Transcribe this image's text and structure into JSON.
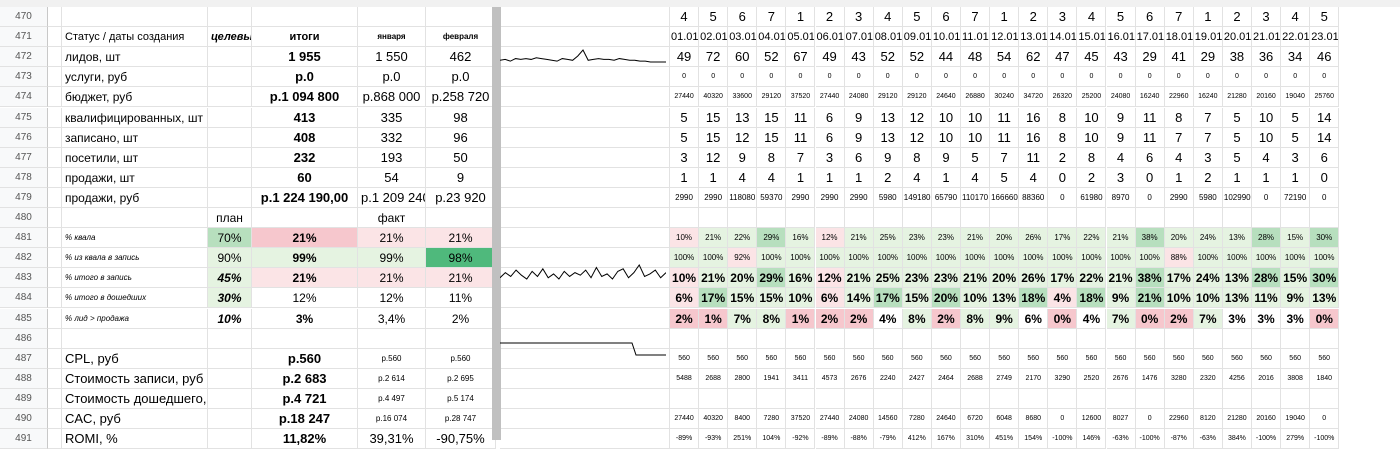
{
  "rows": {
    "470": {
      "cells": {
        "6": "4",
        "7": "5",
        "8": "6",
        "9": "7",
        "10": "1",
        "11": "2",
        "12": "3",
        "13": "4",
        "14": "5",
        "15": "6",
        "16": "7",
        "17": "1",
        "18": "2",
        "19": "3",
        "20": "4",
        "21": "5",
        "22": "6",
        "23": "7",
        "24": "1",
        "25": "2",
        "26": "3",
        "27": "4",
        "28": "5"
      }
    },
    "471": {
      "cells": {
        "1": "Статус / даты создания",
        "2": "целевы",
        "3": "итоги",
        "4": "января",
        "5": "февраля",
        "6": "01.01.",
        "7": "02.01.",
        "8": "03.01.",
        "9": "04.01.",
        "10": "05.01.",
        "11": "06.01.",
        "12": "07.01.",
        "13": "08.01.",
        "14": "09.01.",
        "15": "10.01.",
        "16": "11.01.",
        "17": "12.01.",
        "18": "13.01.",
        "19": "14.01.",
        "20": "15.01.",
        "21": "16.01.",
        "22": "17.01.",
        "23": "18.01.",
        "24": "19.01.",
        "25": "20.01.",
        "26": "21.01.",
        "27": "22.01.",
        "28": "23.01."
      }
    },
    "472": {
      "cells": {
        "1": "лидов, шт",
        "3": "1 955",
        "4": "1 550",
        "5": "462",
        "6": "49",
        "7": "72",
        "8": "60",
        "9": "52",
        "10": "67",
        "11": "49",
        "12": "43",
        "13": "52",
        "14": "52",
        "15": "44",
        "16": "48",
        "17": "54",
        "18": "62",
        "19": "47",
        "20": "45",
        "21": "43",
        "22": "29",
        "23": "41",
        "24": "29",
        "25": "38",
        "26": "36",
        "27": "34",
        "28": "46"
      }
    },
    "473": {
      "cells": {
        "1": "услуги, руб",
        "3": "р.0",
        "4": "р.0",
        "5": "р.0",
        "6": "0",
        "7": "0",
        "8": "0",
        "9": "0",
        "10": "0",
        "11": "0",
        "12": "0",
        "13": "0",
        "14": "0",
        "15": "0",
        "16": "0",
        "17": "0",
        "18": "0",
        "19": "0",
        "20": "0",
        "21": "0",
        "22": "0",
        "23": "0",
        "24": "0",
        "25": "0",
        "26": "0",
        "27": "0",
        "28": "0"
      }
    },
    "474": {
      "cells": {
        "1": "бюджет, руб",
        "3": "р.1 094 800",
        "4": "р.868 000",
        "5": "р.258 720",
        "6": "27440",
        "7": "40320",
        "8": "33600",
        "9": "29120",
        "10": "37520",
        "11": "27440",
        "12": "24080",
        "13": "29120",
        "14": "29120",
        "15": "24640",
        "16": "26880",
        "17": "30240",
        "18": "34720",
        "19": "26320",
        "20": "25200",
        "21": "24080",
        "22": "16240",
        "23": "22960",
        "24": "16240",
        "25": "21280",
        "26": "20160",
        "27": "19040",
        "28": "25760"
      }
    },
    "475": {
      "cells": {
        "1": "квалифицированных, шт",
        "3": "413",
        "4": "335",
        "5": "98",
        "6": "5",
        "7": "15",
        "8": "13",
        "9": "15",
        "10": "11",
        "11": "6",
        "12": "9",
        "13": "13",
        "14": "12",
        "15": "10",
        "16": "10",
        "17": "11",
        "18": "16",
        "19": "8",
        "20": "10",
        "21": "9",
        "22": "11",
        "23": "8",
        "24": "7",
        "25": "5",
        "26": "10",
        "27": "5",
        "28": "14"
      }
    },
    "476": {
      "cells": {
        "1": "записано, шт",
        "3": "408",
        "4": "332",
        "5": "96",
        "6": "5",
        "7": "15",
        "8": "12",
        "9": "15",
        "10": "11",
        "11": "6",
        "12": "9",
        "13": "13",
        "14": "12",
        "15": "10",
        "16": "10",
        "17": "11",
        "18": "16",
        "19": "8",
        "20": "10",
        "21": "9",
        "22": "11",
        "23": "7",
        "24": "7",
        "25": "5",
        "26": "10",
        "27": "5",
        "28": "14"
      }
    },
    "477": {
      "cells": {
        "1": "посетили, шт",
        "3": "232",
        "4": "193",
        "5": "50",
        "6": "3",
        "7": "12",
        "8": "9",
        "9": "8",
        "10": "7",
        "11": "3",
        "12": "6",
        "13": "9",
        "14": "8",
        "15": "9",
        "16": "5",
        "17": "7",
        "18": "11",
        "19": "2",
        "20": "8",
        "21": "4",
        "22": "6",
        "23": "4",
        "24": "3",
        "25": "5",
        "26": "4",
        "27": "3",
        "28": "6"
      }
    },
    "478": {
      "cells": {
        "1": "продажи, шт",
        "3": "60",
        "4": "54",
        "5": "9",
        "6": "1",
        "7": "1",
        "8": "4",
        "9": "4",
        "10": "1",
        "11": "1",
        "12": "1",
        "13": "2",
        "14": "4",
        "15": "1",
        "16": "4",
        "17": "5",
        "18": "4",
        "19": "0",
        "20": "2",
        "21": "3",
        "22": "0",
        "23": "1",
        "24": "2",
        "25": "1",
        "26": "1",
        "27": "1",
        "28": "0"
      }
    },
    "479": {
      "cells": {
        "1": "продажи, руб",
        "3": "р.1 224 190,00",
        "4": "р.1 209 240",
        "5": "р.23 920",
        "6": "2990",
        "7": "2990",
        "8": "118080",
        "9": "59370",
        "10": "2990",
        "11": "2990",
        "12": "2990",
        "13": "5980",
        "14": "149180",
        "15": "65790",
        "16": "110170",
        "17": "166660",
        "18": "88360",
        "19": "0",
        "20": "61980",
        "21": "8970",
        "22": "0",
        "23": "2990",
        "24": "5980",
        "25": "102990",
        "26": "0",
        "27": "72190",
        "28": "0"
      }
    },
    "480": {
      "cells": {
        "2": "план",
        "4": "факт"
      }
    },
    "481": {
      "cells": {
        "1": "% квала",
        "2": "70%",
        "3": "21%",
        "4": "21%",
        "5": "21%",
        "6": "10%",
        "7": "21%",
        "8": "22%",
        "9": "29%",
        "10": "16%",
        "11": "12%",
        "12": "21%",
        "13": "25%",
        "14": "23%",
        "15": "23%",
        "16": "21%",
        "17": "20%",
        "18": "26%",
        "19": "17%",
        "20": "22%",
        "21": "21%",
        "22": "38%",
        "23": "20%",
        "24": "24%",
        "25": "13%",
        "26": "28%",
        "27": "15%",
        "28": "30%"
      }
    },
    "482": {
      "cells": {
        "1": "% из квала в запись",
        "2": "90%",
        "3": "99%",
        "4": "99%",
        "5": "98%",
        "6": "100%",
        "7": "100%",
        "8": "92%",
        "9": "100%",
        "10": "100%",
        "11": "100%",
        "12": "100%",
        "13": "100%",
        "14": "100%",
        "15": "100%",
        "16": "100%",
        "17": "100%",
        "18": "100%",
        "19": "100%",
        "20": "100%",
        "21": "100%",
        "22": "100%",
        "23": "88%",
        "24": "100%",
        "25": "100%",
        "26": "100%",
        "27": "100%",
        "28": "100%"
      }
    },
    "483": {
      "cells": {
        "1": "% итого в запись",
        "2": "45%",
        "3": "21%",
        "4": "21%",
        "5": "21%",
        "6": "10%",
        "7": "21%",
        "8": "20%",
        "9": "29%",
        "10": "16%",
        "11": "12%",
        "12": "21%",
        "13": "25%",
        "14": "23%",
        "15": "23%",
        "16": "21%",
        "17": "20%",
        "18": "26%",
        "19": "17%",
        "20": "22%",
        "21": "21%",
        "22": "38%",
        "23": "17%",
        "24": "24%",
        "25": "13%",
        "26": "28%",
        "27": "15%",
        "28": "30%"
      }
    },
    "484": {
      "cells": {
        "1": "% итого в дошедших",
        "2": "30%",
        "3": "12%",
        "4": "12%",
        "5": "11%",
        "6": "6%",
        "7": "17%",
        "8": "15%",
        "9": "15%",
        "10": "10%",
        "11": "6%",
        "12": "14%",
        "13": "17%",
        "14": "15%",
        "15": "20%",
        "16": "10%",
        "17": "13%",
        "18": "18%",
        "19": "4%",
        "20": "18%",
        "21": "9%",
        "22": "21%",
        "23": "10%",
        "24": "10%",
        "25": "13%",
        "26": "11%",
        "27": "9%",
        "28": "13%"
      }
    },
    "485": {
      "cells": {
        "1": "% лид > продажа",
        "2": "10%",
        "3": "3%",
        "4": "3,4%",
        "5": "2%",
        "6": "2%",
        "7": "1%",
        "8": "7%",
        "9": "8%",
        "10": "1%",
        "11": "2%",
        "12": "2%",
        "13": "4%",
        "14": "8%",
        "15": "2%",
        "16": "8%",
        "17": "9%",
        "18": "6%",
        "19": "0%",
        "20": "4%",
        "21": "7%",
        "22": "0%",
        "23": "2%",
        "24": "7%",
        "25": "3%",
        "26": "3%",
        "27": "3%",
        "28": "0%"
      }
    },
    "486": {
      "cells": {}
    },
    "487": {
      "cells": {
        "1": "CPL, руб",
        "3": "р.560",
        "4": "р.560",
        "5": "р.560",
        "6": "560",
        "7": "560",
        "8": "560",
        "9": "560",
        "10": "560",
        "11": "560",
        "12": "560",
        "13": "560",
        "14": "560",
        "15": "560",
        "16": "560",
        "17": "560",
        "18": "560",
        "19": "560",
        "20": "560",
        "21": "560",
        "22": "560",
        "23": "560",
        "24": "560",
        "25": "560",
        "26": "560",
        "27": "560",
        "28": "560"
      }
    },
    "488": {
      "cells": {
        "1": "Стоимость записи, руб",
        "3": "р.2 683",
        "4": "р.2 614",
        "5": "р.2 695",
        "6": "5488",
        "7": "2688",
        "8": "2800",
        "9": "1941",
        "10": "3411",
        "11": "4573",
        "12": "2676",
        "13": "2240",
        "14": "2427",
        "15": "2464",
        "16": "2688",
        "17": "2749",
        "18": "2170",
        "19": "3290",
        "20": "2520",
        "21": "2676",
        "22": "1476",
        "23": "3280",
        "24": "2320",
        "25": "4256",
        "26": "2016",
        "27": "3808",
        "28": "1840"
      }
    },
    "489": {
      "cells": {
        "1": "Стоимость дошедшего, руб",
        "3": "р.4 721",
        "4": "р.4 497",
        "5": "р.5 174"
      }
    },
    "490": {
      "cells": {
        "1": "CAC, руб",
        "3": "р.18 247",
        "4": "р.16 074",
        "5": "р.28 747",
        "6": "27440",
        "7": "40320",
        "8": "8400",
        "9": "7280",
        "10": "37520",
        "11": "27440",
        "12": "24080",
        "13": "14560",
        "14": "7280",
        "15": "24640",
        "16": "6720",
        "17": "6048",
        "18": "8680",
        "19": "0",
        "20": "12600",
        "21": "8027",
        "22": "0",
        "23": "22960",
        "24": "8120",
        "25": "21280",
        "26": "20160",
        "27": "19040",
        "28": "0"
      }
    },
    "491": {
      "cells": {
        "1": "ROMI, %",
        "3": "11,82%",
        "4": "39,31%",
        "5": "-90,75%",
        "6": "-89%",
        "7": "-93%",
        "8": "251%",
        "9": "104%",
        "10": "-92%",
        "11": "-89%",
        "12": "-88%",
        "13": "-79%",
        "14": "412%",
        "15": "167%",
        "16": "310%",
        "17": "451%",
        "18": "154%",
        "19": "-100%",
        "20": "146%",
        "21": "-63%",
        "22": "-100%",
        "23": "-87%",
        "24": "-63%",
        "25": "384%",
        "26": "-100%",
        "27": "279%",
        "28": "-100%"
      }
    }
  },
  "colors": {
    "light_green": "#e5f3e1",
    "mid_green": "#b7dfbe",
    "strong_green": "#4fb97c",
    "light_red": "#fbe4e6",
    "mid_red": "#f6c7cd"
  }
}
